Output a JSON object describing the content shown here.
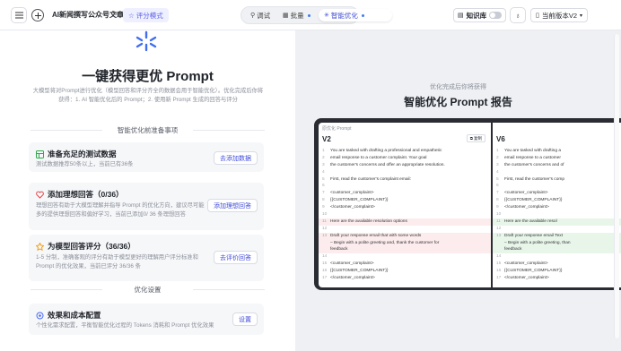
{
  "header": {
    "doc_title": "AI新闻撰写公众号文章",
    "mode_label": "评分模式",
    "tabs": [
      {
        "label": "调试",
        "icon": "debug-icon"
      },
      {
        "label": "批量",
        "icon": "grid-icon"
      },
      {
        "label": "智能优化",
        "icon": "sparkle-icon"
      }
    ],
    "knowledge_label": "知识库",
    "version_label": "当前版本V2"
  },
  "left": {
    "title": "一键获得更优 Prompt",
    "description": "大模型将对Prompt进行优化（模型回答和评分齐全的数据会用于智能优化）。优化完成后你将获得：1. AI 智能优化后的 Prompt；2. 使用新 Prompt 生成的回答与评分",
    "prep_section": "智能优化前准备事项",
    "cards": [
      {
        "title": "准备充足的测试数据",
        "desc": "测试数据推荐50条以上，当前已有36条",
        "button": "去添加数据"
      },
      {
        "title": "添加理想回答（0/36）",
        "desc": "理想回答有助于大模型理解并指导 Prompt 的优化方向，建议尽可能多的提供理想回答和偏好学习，当前已添加0/ 36 条理想回答",
        "button": "添加理想回答"
      },
      {
        "title": "为模型回答评分（36/36）",
        "desc": "1-5 分制，准确客观的评分有助于模型更好的理解用户评分标准和 Prompt 的优化效果，当前已评分 36/36 条",
        "button": "去评价回答"
      }
    ],
    "config_section": "优化设置",
    "config_card": {
      "title": "效果和成本配置",
      "desc": "个性化需求配置，平衡智能优化过程的 Tokens 消耗和 Prompt 优化效果",
      "button": "设置"
    }
  },
  "right": {
    "subtitle": "优化完成后你将获得",
    "title": "智能优化 Prompt 报告",
    "preview": {
      "left_label": "原优化 Prompt",
      "left_version": "V2",
      "copy_label": "复制",
      "right_version": "V6",
      "left_lines": [
        {
          "n": "1",
          "t": "You are tasked with drafting a professional and empathetic"
        },
        {
          "n": "2",
          "t": "email response to a customer complaint. Your goal"
        },
        {
          "n": "3",
          "t": "the customer's concerns and offer an appropriate resolution."
        },
        {
          "n": "4",
          "t": ""
        },
        {
          "n": "5",
          "t": "First, read the customer's complaint email:"
        },
        {
          "n": "6",
          "t": ""
        },
        {
          "n": "7",
          "t": "<customer_complaint>"
        },
        {
          "n": "8",
          "t": "{{CUSTOMER_COMPLAINT}}"
        },
        {
          "n": "9",
          "t": "</customer_complaint>"
        },
        {
          "n": "10",
          "t": ""
        },
        {
          "n": "11",
          "t": "Here are the available resolution options"
        },
        {
          "n": "12",
          "t": ""
        },
        {
          "n": "13",
          "t": "Draft your response email that with some words"
        },
        {
          "n": "",
          "t": "– Begin with a polite greeting and, thank the customer for"
        },
        {
          "n": "",
          "t": "feedback"
        },
        {
          "n": "14",
          "t": ""
        },
        {
          "n": "15",
          "t": "<customer_complaint>"
        },
        {
          "n": "16",
          "t": "{{CUSTOMER_COMPLAINT}}"
        },
        {
          "n": "17",
          "t": "</customer_complaint>"
        }
      ],
      "right_lines": [
        {
          "n": "1",
          "t": "You are tasked with drafting a"
        },
        {
          "n": "2",
          "t": "email response to a customer"
        },
        {
          "n": "3",
          "t": "the customer's concerns and of"
        },
        {
          "n": "4",
          "t": ""
        },
        {
          "n": "5",
          "t": "First, read the customer's comp"
        },
        {
          "n": "6",
          "t": ""
        },
        {
          "n": "7",
          "t": "<customer_complaint>"
        },
        {
          "n": "8",
          "t": "{{CUSTOMER_COMPLAINT}}"
        },
        {
          "n": "9",
          "t": "</customer_complaint>"
        },
        {
          "n": "10",
          "t": ""
        },
        {
          "n": "11",
          "t": "Here are the available resol"
        },
        {
          "n": "12",
          "t": ""
        },
        {
          "n": "13",
          "t": "Draft your response email Text"
        },
        {
          "n": "",
          "t": "– Begin with a polite greeting, than"
        },
        {
          "n": "",
          "t": "feedback"
        },
        {
          "n": "14",
          "t": ""
        },
        {
          "n": "15",
          "t": "<customer_complaint>"
        },
        {
          "n": "16",
          "t": "{{CUSTOMER_COMPLAINT}}"
        },
        {
          "n": "17",
          "t": "</customer_complaint>"
        }
      ]
    }
  },
  "colors": {
    "accent": "#3f4bd8",
    "diff_removed": "#fdecee",
    "diff_added": "#e8f6ea"
  }
}
